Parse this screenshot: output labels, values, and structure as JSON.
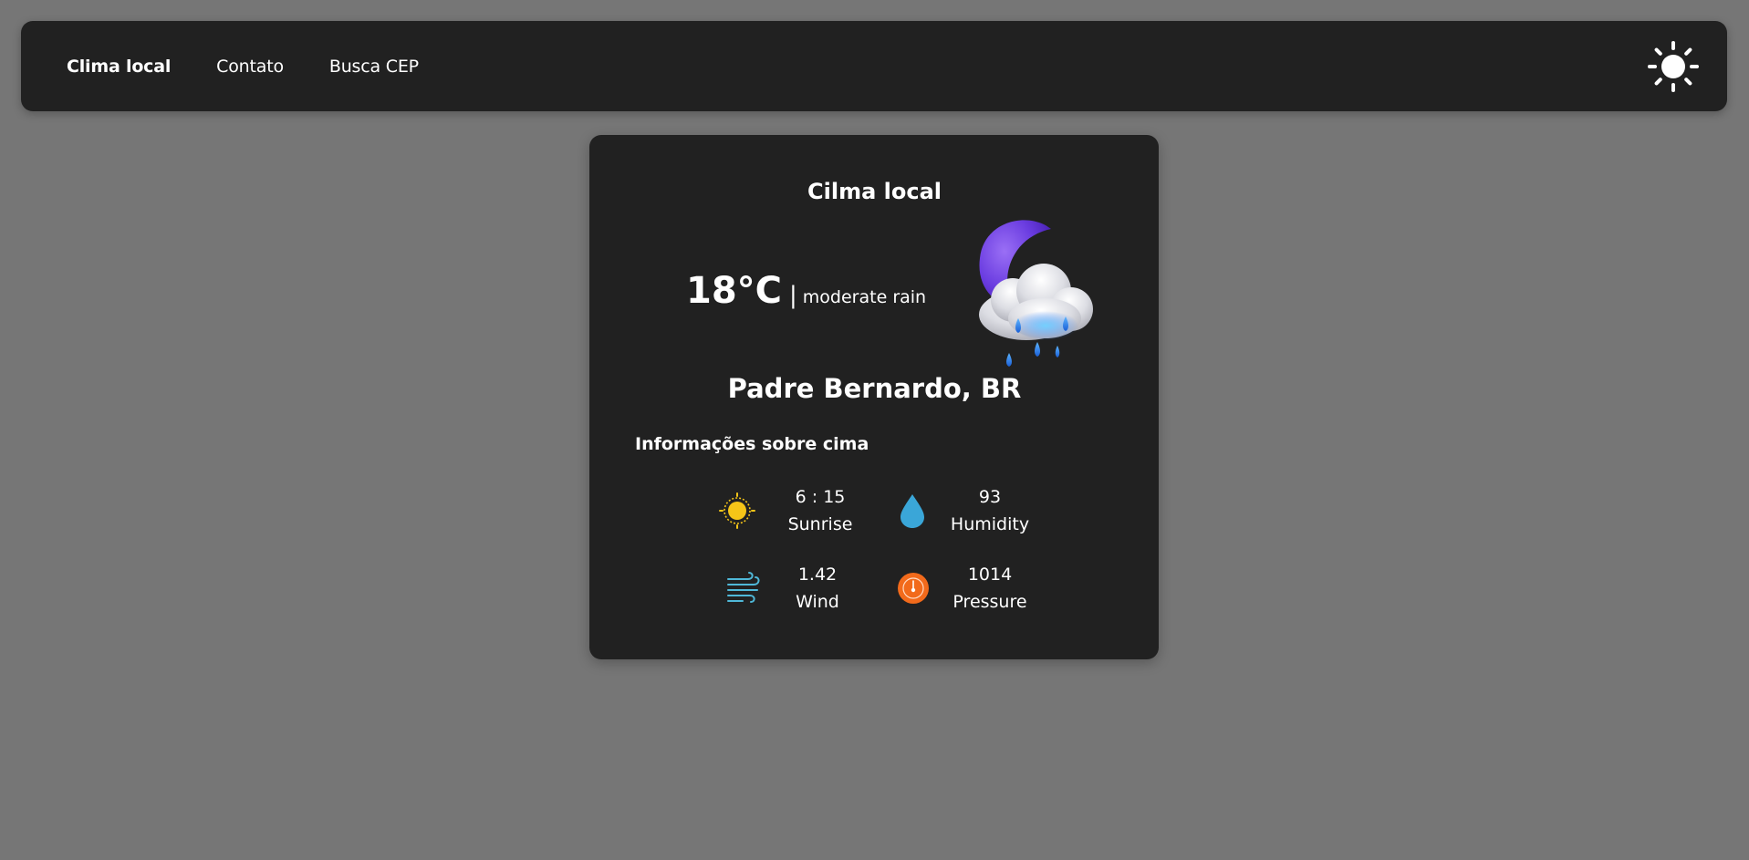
{
  "nav": {
    "links": [
      {
        "label": "Clima local"
      },
      {
        "label": "Contato"
      },
      {
        "label": "Busca CEP"
      }
    ],
    "theme_icon": "sun-icon"
  },
  "card": {
    "title": "Cilma local",
    "temperature": "18°C",
    "separator": "|",
    "description": "moderate rain",
    "weather_icon": "moon-cloud-rain-icon",
    "location": "Padre Bernardo, BR",
    "info_heading": "Informações sobre cima",
    "info": [
      {
        "value": "6 : 15",
        "label": "Sunrise",
        "icon": "sunrise-icon",
        "color": "#f5c518"
      },
      {
        "value": "93",
        "label": "Humidity",
        "icon": "water-drop-icon",
        "color": "#3aa6d8"
      },
      {
        "value": "1.42",
        "label": "Wind",
        "icon": "wind-icon",
        "color": "#4fb8d8"
      },
      {
        "value": "1014",
        "label": "Pressure",
        "icon": "pressure-gauge-icon",
        "color": "#f26a1b"
      }
    ]
  }
}
